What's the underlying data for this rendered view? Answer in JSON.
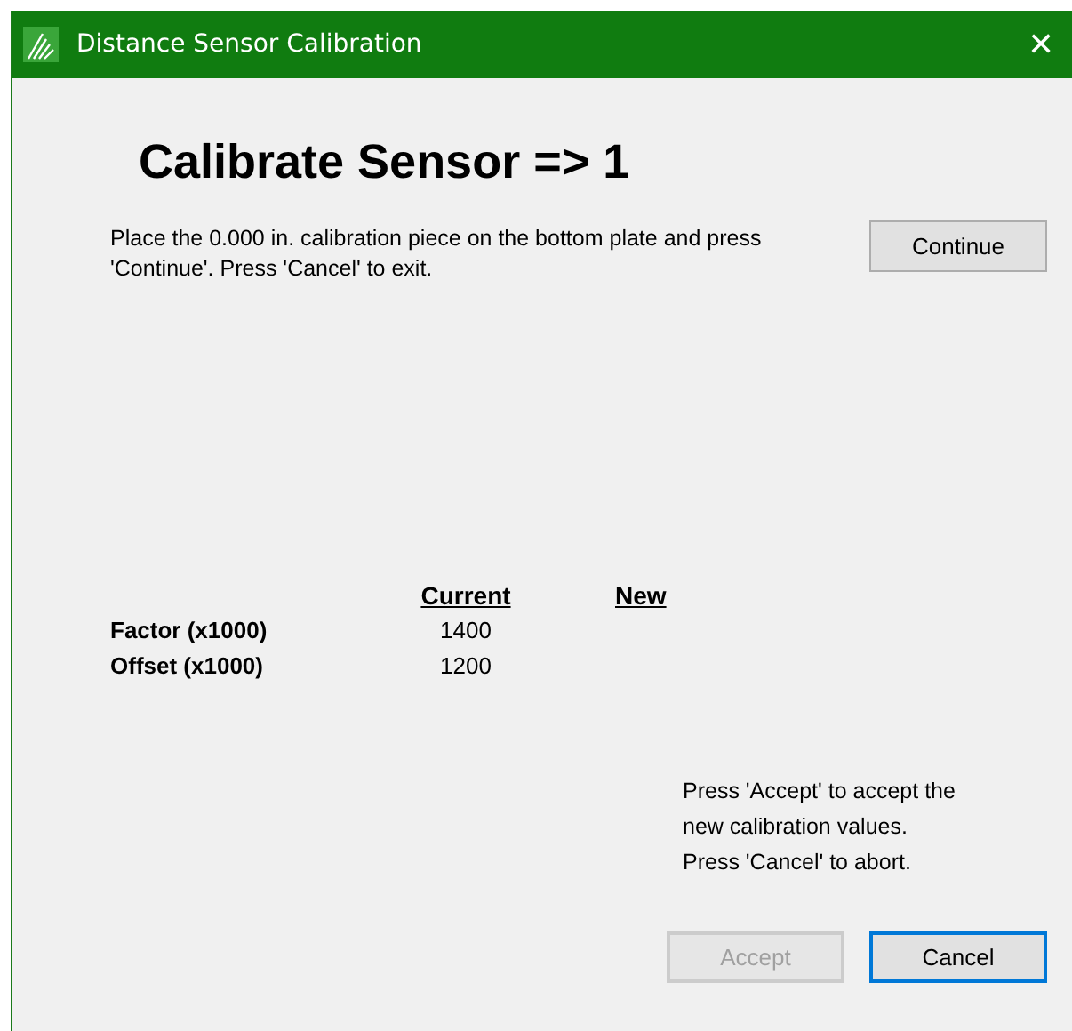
{
  "window": {
    "title": "Distance Sensor Calibration",
    "close": "✕"
  },
  "heading": "Calibrate Sensor => 1",
  "instruction": "Place the 0.000 in. calibration piece on the bottom plate and press 'Continue'.  Press 'Cancel' to exit.",
  "continue_button": {
    "label": "Continue",
    "disabled": false,
    "focused": false
  },
  "table": {
    "columns": [
      "Current",
      "New"
    ],
    "rows": [
      {
        "label": "Factor (x1000)",
        "current": "1400"
      },
      {
        "label": "Offset (x1000)",
        "current": "1200"
      }
    ]
  },
  "accept_note": [
    "Press 'Accept' to accept the",
    "new calibration values.",
    "Press 'Cancel' to abort."
  ],
  "buttons": [
    {
      "label": "Accept",
      "disabled": true,
      "focused": false
    },
    {
      "label": "Cancel",
      "disabled": false,
      "focused": true
    }
  ]
}
